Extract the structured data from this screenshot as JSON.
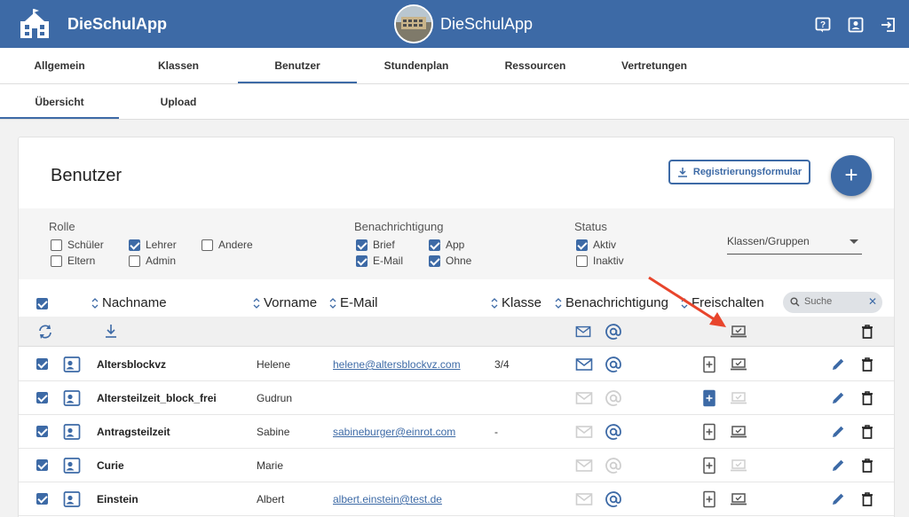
{
  "header": {
    "app_title": "DieSchulApp",
    "center_title": "DieSchulApp",
    "color": "#3d6aa6"
  },
  "main_tabs": [
    "Allgemein",
    "Klassen",
    "Benutzer",
    "Stundenplan",
    "Ressourcen",
    "Vertretungen"
  ],
  "active_main_tab": "Benutzer",
  "sub_tabs": [
    "Übersicht",
    "Upload"
  ],
  "active_sub_tab": "Übersicht",
  "page": {
    "title": "Benutzer",
    "register_button": "Registrierungsformular",
    "add_button": "+"
  },
  "filters": {
    "rolle": {
      "label": "Rolle",
      "options": [
        {
          "label": "Schüler",
          "checked": false
        },
        {
          "label": "Lehrer",
          "checked": true
        },
        {
          "label": "Andere",
          "checked": false
        },
        {
          "label": "Eltern",
          "checked": false
        },
        {
          "label": "Admin",
          "checked": false
        }
      ]
    },
    "benachrichtigung": {
      "label": "Benachrichtigung",
      "options": [
        {
          "label": "Brief",
          "checked": true
        },
        {
          "label": "App",
          "checked": true
        },
        {
          "label": "E-Mail",
          "checked": true
        },
        {
          "label": "Ohne",
          "checked": true
        }
      ]
    },
    "status": {
      "label": "Status",
      "options": [
        {
          "label": "Aktiv",
          "checked": true
        },
        {
          "label": "Inaktiv",
          "checked": false
        }
      ]
    },
    "klassen_select": "Klassen/Gruppen"
  },
  "table": {
    "columns": [
      "Nachname",
      "Vorname",
      "E-Mail",
      "Klasse",
      "Benachrichtigung",
      "Freischalten"
    ],
    "search_placeholder": "Suche",
    "rows": [
      {
        "nachname": "Altersblockvz",
        "vorname": "Helene",
        "email": "helene@altersblockvz.com",
        "klasse": "3/4",
        "mail_active": true,
        "at_active": true,
        "plus_highlight": false,
        "freischalten_active": true
      },
      {
        "nachname": "Altersteilzeit_block_frei",
        "vorname": "Gudrun",
        "email": "",
        "klasse": "",
        "mail_active": false,
        "at_active": false,
        "plus_highlight": true,
        "freischalten_active": false
      },
      {
        "nachname": "Antragsteilzeit",
        "vorname": "Sabine",
        "email": "sabineburger@einrot.com",
        "klasse": "-",
        "mail_active": false,
        "at_active": true,
        "plus_highlight": false,
        "freischalten_active": true
      },
      {
        "nachname": "Curie",
        "vorname": "Marie",
        "email": "",
        "klasse": "",
        "mail_active": false,
        "at_active": false,
        "plus_highlight": false,
        "freischalten_active": false
      },
      {
        "nachname": "Einstein",
        "vorname": "Albert",
        "email": "albert.einstein@test.de",
        "klasse": "",
        "mail_active": false,
        "at_active": true,
        "plus_highlight": false,
        "freischalten_active": true
      }
    ]
  },
  "icons": {
    "logo": "school-building-icon",
    "help": "help-icon",
    "profile": "profile-icon",
    "logout": "logout-icon",
    "download": "download-icon",
    "refresh": "refresh-icon",
    "mail": "mail-icon",
    "at": "at-icon",
    "laptop": "laptop-icon",
    "device_plus": "device-plus-icon",
    "edit": "edit-icon",
    "delete": "delete-icon",
    "search": "search-icon",
    "contact_card": "contact-card-icon"
  },
  "colors": {
    "accent": "#3d6aa6",
    "annotation_arrow": "#e8452c",
    "inactive_icon": "#cfcfcf"
  }
}
